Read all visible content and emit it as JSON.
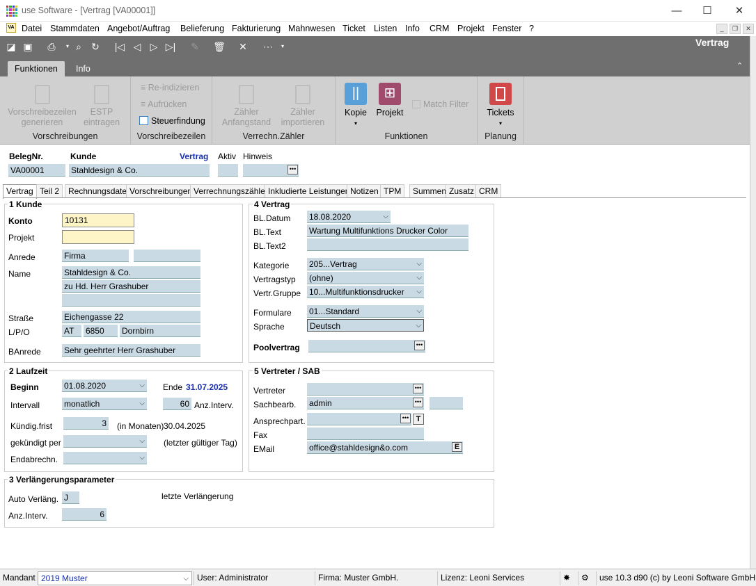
{
  "window": {
    "title": "use Software - [Vertrag [VA00001]]",
    "minimize": "—",
    "maximize": "☐",
    "close": "✕"
  },
  "menu": {
    "items": [
      "Datei",
      "Stammdaten",
      "Angebot/Auftrag",
      "Belieferung",
      "Fakturierung",
      "Mahnwesen",
      "Ticket",
      "Listen",
      "Info",
      "CRM",
      "Projekt",
      "Fenster",
      "?"
    ]
  },
  "toolbar": {
    "form_title": "Vertrag"
  },
  "ribbon": {
    "tabs": [
      "Funktionen",
      "Info"
    ],
    "groups": {
      "vorschreibungen": {
        "label": "Vorschreibungen",
        "btn1": "Vorschreibezeilen",
        "btn1b": "generieren",
        "btn2": "ESTP",
        "btn2b": "eintragen"
      },
      "vorschreibezeilen": {
        "label": "Vorschreibezeilen",
        "reindex": "Re-indizieren",
        "aufruecken": "Aufrücken",
        "steuerfindung": "Steuerfindung"
      },
      "zaehler": {
        "label": "Verrechn.Zähler",
        "btn1": "Zähler",
        "btn1b": "Anfangstand",
        "btn2": "Zähler",
        "btn2b": "importieren"
      },
      "funktionen": {
        "label": "Funktionen",
        "kopie": "Kopie",
        "projekt": "Projekt",
        "match": "Match Filter"
      },
      "planung": {
        "label": "Planung",
        "tickets": "Tickets"
      }
    }
  },
  "header": {
    "belegnr_label": "BelegNr.",
    "belegnr": "VA00001",
    "kunde_label": "Kunde",
    "kunde": "Stahldesign & Co.",
    "type": "Vertrag",
    "aktiv_label": "Aktiv",
    "hinweis_label": "Hinweis"
  },
  "tabs": [
    "Vertrag",
    "Teil 2",
    "Rechnungsdaten",
    "Vorschreibungen",
    "Verrechnungszähler",
    "Inkludierte Leistungen",
    "Notizen",
    "TPM",
    "Summen",
    "Zusatz",
    "CRM"
  ],
  "kunde": {
    "title": "1 Kunde",
    "konto_label": "Konto",
    "konto": "10131",
    "projekt_label": "Projekt",
    "anrede_label": "Anrede",
    "anrede": "Firma",
    "name_label": "Name",
    "name1": "Stahldesign & Co.",
    "name2": "zu Hd. Herr Grashuber",
    "strasse_label": "Straße",
    "strasse": "Eichengasse 22",
    "lpo_label": "L/P/O",
    "land": "AT",
    "plz": "6850",
    "ort": "Dornbirn",
    "banrede_label": "BAnrede",
    "banrede": "Sehr geehrter Herr Grashuber"
  },
  "vertrag": {
    "title": "4 Vertrag",
    "bldatum_label": "BL.Datum",
    "bldatum": "18.08.2020",
    "bltext_label": "BL.Text",
    "bltext": "Wartung Multifunktions Drucker Color",
    "bltext2_label": "BL.Text2",
    "kategorie_label": "Kategorie",
    "kategorie": "205...Vertrag",
    "vertragstyp_label": "Vertragstyp",
    "vertragstyp": "(ohne)",
    "gruppe_label": "Vertr.Gruppe",
    "gruppe": "10...Multifunktionsdrucker",
    "formulare_label": "Formulare",
    "formulare": "01...Standard",
    "sprache_label": "Sprache",
    "sprache": "Deutsch",
    "pool_label": "Poolvertrag"
  },
  "laufzeit": {
    "title": "2 Laufzeit",
    "beginn_label": "Beginn",
    "beginn": "01.08.2020",
    "ende_label": "Ende",
    "ende": "31.07.2025",
    "intervall_label": "Intervall",
    "intervall": "monatlich",
    "anz": "60",
    "anz_label": "Anz.Interv.",
    "kuend_label": "Kündig.frist",
    "kuend": "3",
    "monate_label": "(in Monaten)",
    "kuend_date": "30.04.2025",
    "gekuendigt_label": "gekündigt per",
    "letzter_label": "(letzter gültiger Tag)",
    "endabr_label": "Endabrechn."
  },
  "vertreter": {
    "title": "5 Vertreter / SAB",
    "vertreter_label": "Vertreter",
    "sachb_label": "Sachbearb.",
    "sachb": "admin",
    "ansp_label": "Ansprechpart.",
    "fax_label": "Fax",
    "email_label": "EMail",
    "email": "office@stahldesign&o.com",
    "t_btn": "T",
    "e_btn": "E"
  },
  "verl": {
    "title": "3 Verlängerungsparameter",
    "auto_label": "Auto Verläng.",
    "auto": "J",
    "letzte_label": "letzte Verlängerung",
    "anz_label": "Anz.Interv.",
    "anz": "6"
  },
  "status": {
    "mandant_label": "Mandant",
    "mandant": "2019 Muster",
    "user": "User: Administrator",
    "firma": "Firma: Muster GmbH.",
    "lizenz": "Lizenz: Leoni Services",
    "version": "use 10.3 d90 (c) by Leoni Software GmbH"
  },
  "colors": {
    "toolbar": "#6f6f6f",
    "ribbon": "#d0d0d0",
    "field": "#cadae4",
    "field_yellow": "#fdf5c8",
    "kopie": "#5aa0d8",
    "projekt": "#a04a6c",
    "tickets": "#d04848",
    "vertrag_blue": "#1a2fb0"
  }
}
